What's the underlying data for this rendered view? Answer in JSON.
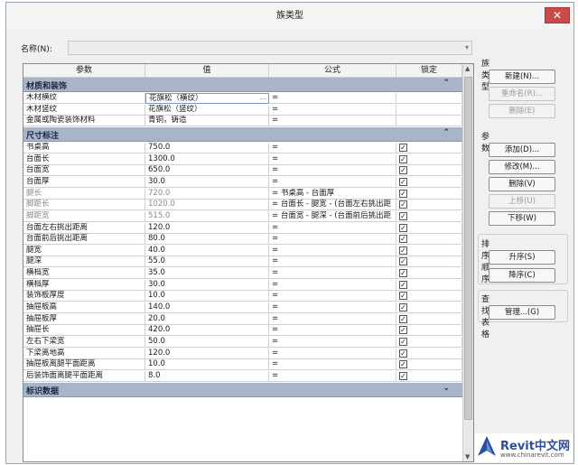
{
  "window": {
    "title": "族类型",
    "close": "✕"
  },
  "name_label": "名称(N):",
  "name_value": "",
  "columns": {
    "param": "参数",
    "value": "值",
    "formula": "公式",
    "lock": "锁定"
  },
  "groups": [
    {
      "label": "材质和装饰",
      "chevron": "⌃",
      "rows": [
        {
          "param": "木材横纹",
          "value": "花旗松（横纹）",
          "formula": "=",
          "lock": "",
          "dim": false,
          "edit": true
        },
        {
          "param": "木材竖纹",
          "value": "花旗松（竖纹）",
          "formula": "=",
          "lock": "",
          "dim": false
        },
        {
          "param": "金属或陶瓷装饰材料",
          "value": "青铜，铸造",
          "formula": "=",
          "lock": "",
          "dim": false
        }
      ]
    },
    {
      "label": "尺寸标注",
      "chevron": "⌃",
      "rows": [
        {
          "param": "书桌高",
          "value": "750.0",
          "formula": "=",
          "lock": "✓"
        },
        {
          "param": "台面长",
          "value": "1300.0",
          "formula": "=",
          "lock": "✓"
        },
        {
          "param": "台面宽",
          "value": "650.0",
          "formula": "=",
          "lock": "✓"
        },
        {
          "param": "台面厚",
          "value": "30.0",
          "formula": "=",
          "lock": "✓"
        },
        {
          "param": "腿长",
          "value": "720.0",
          "formula": "= 书桌高 - 台面厚",
          "lock": "✓",
          "dim": true
        },
        {
          "param": "脚距长",
          "value": "1020.0",
          "formula": "= 台面长 - 腿宽 - (台面左右挑出距",
          "lock": "✓",
          "dim": true
        },
        {
          "param": "脚距宽",
          "value": "515.0",
          "formula": "= 台面宽 - 腿深 - (台面前后挑出距",
          "lock": "✓",
          "dim": true
        },
        {
          "param": "台面左右挑出距离",
          "value": "120.0",
          "formula": "=",
          "lock": "✓"
        },
        {
          "param": "台面前后挑出距离",
          "value": "80.0",
          "formula": "=",
          "lock": "✓"
        },
        {
          "param": "腿宽",
          "value": "40.0",
          "formula": "=",
          "lock": "✓"
        },
        {
          "param": "腿深",
          "value": "55.0",
          "formula": "=",
          "lock": "✓"
        },
        {
          "param": "横档宽",
          "value": "35.0",
          "formula": "=",
          "lock": "✓"
        },
        {
          "param": "横档厚",
          "value": "30.0",
          "formula": "=",
          "lock": "✓"
        },
        {
          "param": "装饰板厚度",
          "value": "10.0",
          "formula": "=",
          "lock": "✓"
        },
        {
          "param": "抽屉板高",
          "value": "140.0",
          "formula": "=",
          "lock": "✓"
        },
        {
          "param": "抽屉板厚",
          "value": "20.0",
          "formula": "=",
          "lock": "✓"
        },
        {
          "param": "抽屉长",
          "value": "420.0",
          "formula": "=",
          "lock": "✓"
        },
        {
          "param": "左右下梁宽",
          "value": "50.0",
          "formula": "=",
          "lock": "✓"
        },
        {
          "param": "下梁离地高",
          "value": "120.0",
          "formula": "=",
          "lock": "✓"
        },
        {
          "param": "抽屉板离腿平面距离",
          "value": "10.0",
          "formula": "=",
          "lock": "✓"
        },
        {
          "param": "后装饰面离腿平面距离",
          "value": "8.0",
          "formula": "=",
          "lock": "✓"
        }
      ]
    },
    {
      "label": "标识数据",
      "chevron": "⌄",
      "rows": []
    }
  ],
  "side": {
    "family_types": {
      "title": "族类型",
      "new": "新建(N)...",
      "rename": "重命名(R)...",
      "delete": "删除(E)"
    },
    "params": {
      "title": "参数",
      "add": "添加(D)...",
      "modify": "修改(M)...",
      "remove": "删除(V)",
      "up": "上移(U)",
      "down": "下移(W)"
    },
    "sort": {
      "title": "排序顺序",
      "asc": "升序(S)",
      "desc": "降序(C)"
    },
    "lookup": {
      "title": "查找表格",
      "manage": "管理...(G)"
    }
  },
  "watermark": {
    "main": "Revit中文网",
    "url": "www.chinarevit.com"
  }
}
